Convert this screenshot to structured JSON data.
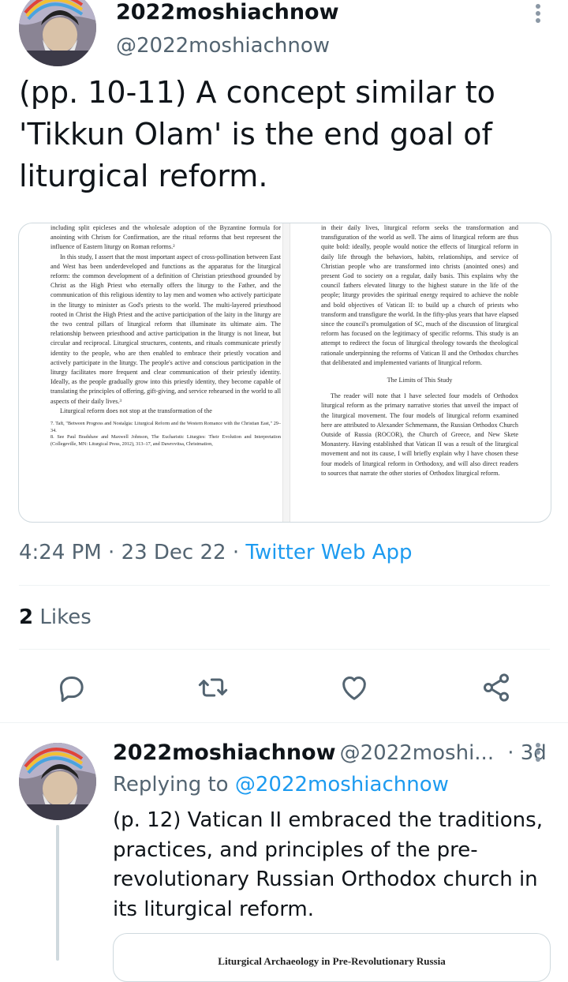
{
  "tweet": {
    "display_name": "2022moshiachnow",
    "handle": "@2022moshiachnow",
    "text": "(pp. 10-11) A concept similar to 'Tikkun Olam' is the end goal of liturgical reform.",
    "media": {
      "left_page": {
        "p1": "including split epicleses and the wholesale adoption of the Byzantine formula for anointing with Chrism for Confirmation, are the ritual reforms that best represent the influence of Eastern liturgy on Roman reforms.²",
        "p2": "In this study, I assert that the most important aspect of cross-pollination between East and West has been underdeveloped and functions as the apparatus for the liturgical reform: the common development of a definition of Christian priesthood grounded by Christ as the High Priest who eternally offers the liturgy to the Father, and the communication of this religious identity to lay men and women who actively participate in the liturgy to minister as God's priests to the world. The multi-layered priesthood rooted in Christ the High Priest and the active participation of the laity in the liturgy are the two central pillars of liturgical reform that illuminate its ultimate aim. The relationship between priesthood and active participation in the liturgy is not linear, but circular and reciprocal. Liturgical structures, contents, and rituals communicate priestly identity to the people, who are then enabled to embrace their priestly vocation and actively participate in the liturgy. The people's active and conscious participation in the liturgy facilitates more frequent and clear communication of their priestly identity. Ideally, as the people gradually grow into this priestly identity, they become capable of translating the principles of offering, gift-giving, and service rehearsed in the world to all aspects of their daily lives.³",
        "p3": "Liturgical reform does not stop at the transformation of the",
        "fn1": "7. Taft, \"Between Progress and Nostalgia: Liturgical Reform and the Western Romance with the Christian East,\" 29–34.",
        "fn2": "8. See Paul Bradshaw and Maxwell Johnson, The Eucharistic Liturgies: Their Evolution and Interpretation (Collegeville, MN: Liturgical Press, 2012), 313–17, and Dawrovitsa, Christmation,"
      },
      "right_page": {
        "p1": "in their daily lives, liturgical reform seeks the transformation and transfiguration of the world as well. The aims of liturgical reform are thus quite bold: ideally, people would notice the effects of liturgical reform in daily life through the behaviors, habits, relationships, and service of Christian people who are transformed into christs (anointed ones) and present God to society on a regular, daily basis. This explains why the council fathers elevated liturgy to the highest stature in the life of the people; liturgy provides the spiritual energy required to achieve the noble and bold objectives of Vatican II: to build up a church of priests who transform and transfigure the world. In the fifty-plus years that have elapsed since the council's promulgation of SC, much of the discussion of liturgical reform has focused on the legitimacy of specific reforms. This study is an attempt to redirect the focus of liturgical theology towards the theological rationale underpinning the reforms of Vatican II and the Orthodox churches that deliberated and implemented variants of liturgical reform.",
        "heading": "The Limits of This Study",
        "p2": "The reader will note that I have selected four models of Orthodox liturgical reform as the primary narrative stories that unveil the impact of the liturgical movement. The four models of liturgical reform examined here are attributed to Alexander Schmemann, the Russian Orthodox Church Outside of Russia (ROCOR), the Church of Greece, and New Skete Monastery. Having established that Vatican II was a result of the liturgical movement and not its cause, I will briefly explain why I have chosen these four models of liturgical reform in Orthodoxy, and will also direct readers to sources that narrate the other stories of Orthodox liturgical reform."
      }
    },
    "time": "4:24 PM",
    "date": "23 Dec 22",
    "source": "Twitter Web App",
    "likes_count": "2",
    "likes_label": "Likes"
  },
  "reply": {
    "display_name": "2022moshiachnow",
    "handle": "@2022moshi...",
    "age": "· 3d",
    "replying_label": "Replying to",
    "replying_to": "@2022moshiachnow",
    "text": "(p. 12) Vatican II embraced the traditions, practices, and principles of the pre-revolutionary Russian Orthodox church in its liturgical reform.",
    "preview_heading": "Liturgical Archaeology in Pre-Revolutionary Russia"
  },
  "icons": [
    "avatar",
    "more-icon",
    "reply-icon",
    "retweet-icon",
    "like-icon",
    "share-icon"
  ],
  "colors": {
    "text": "#0f1419",
    "secondary": "#536471",
    "link": "#1d9bf0",
    "border": "#eff3f4"
  }
}
